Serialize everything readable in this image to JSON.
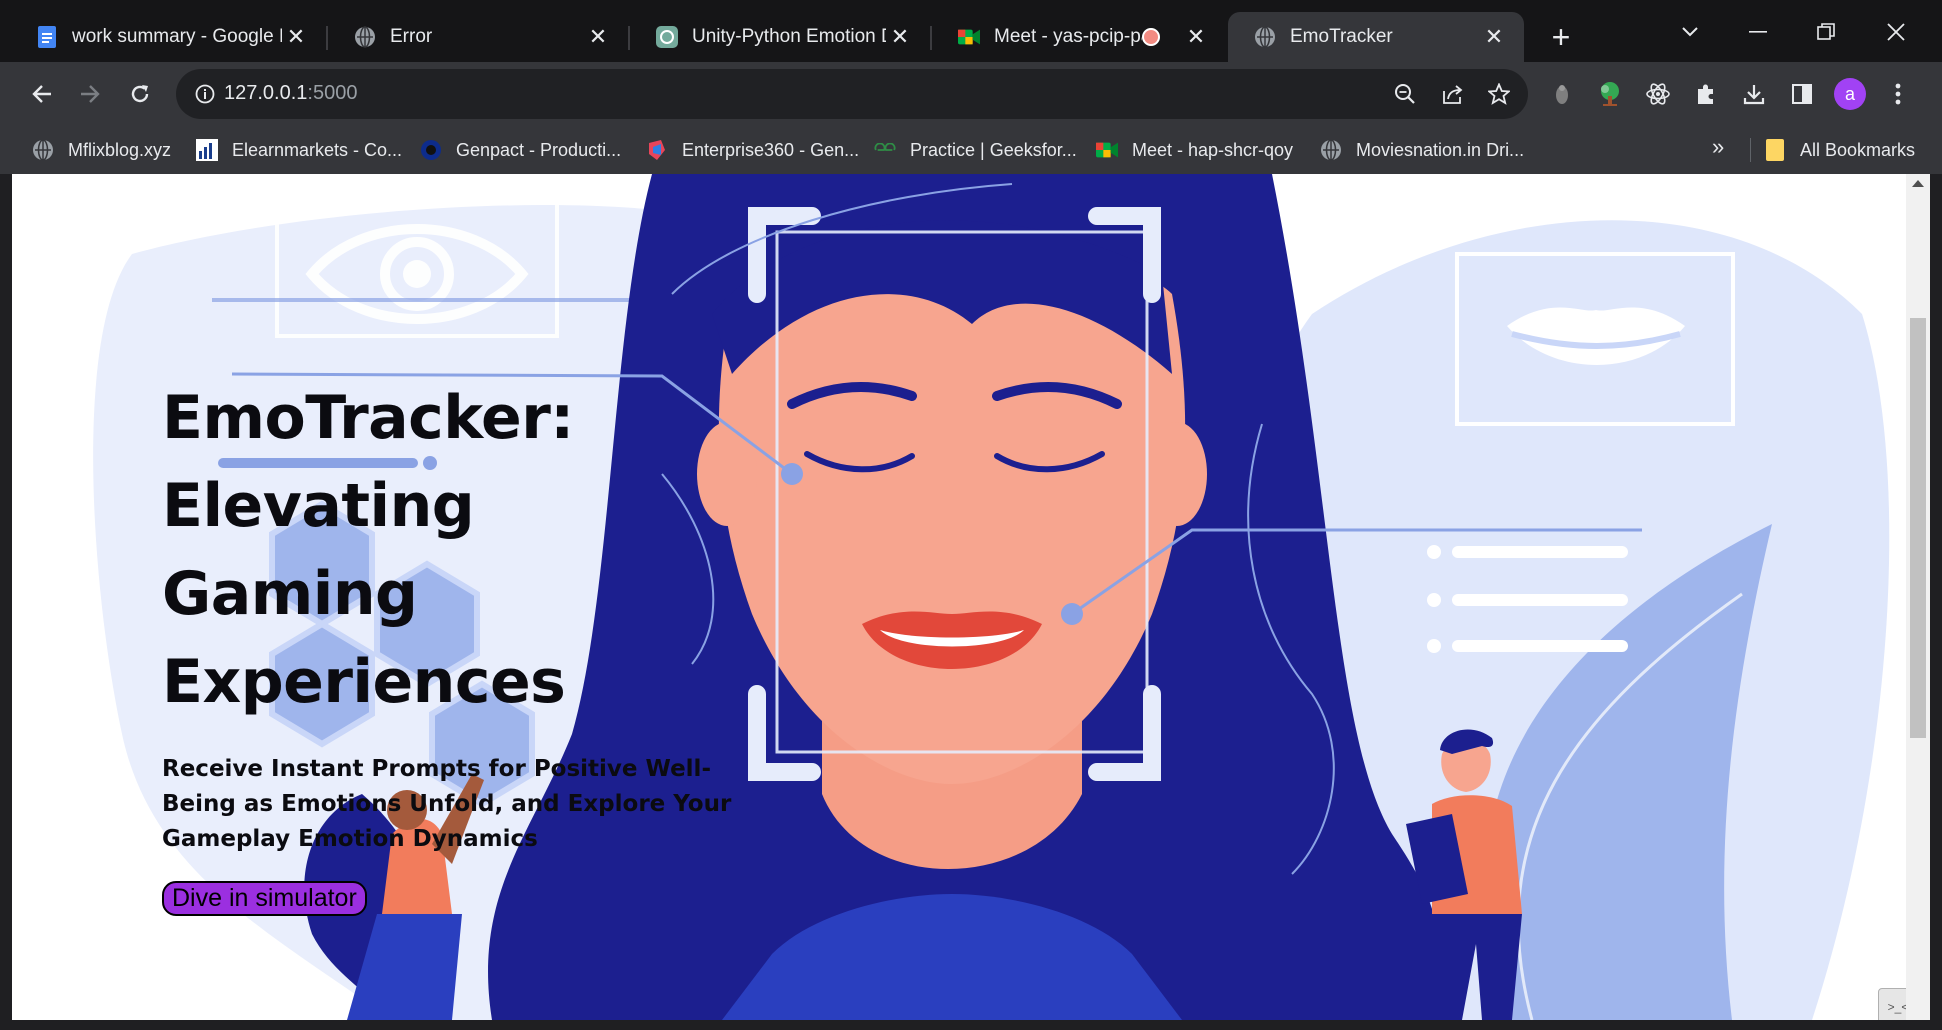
{
  "browser": {
    "tabs": [
      {
        "title": "work summary - Google D",
        "icon": "google-docs-icon"
      },
      {
        "title": "Error",
        "icon": "globe-icon"
      },
      {
        "title": "Unity-Python Emotion Da",
        "icon": "chatgpt-icon"
      },
      {
        "title": "Meet - yas-pcip-paj",
        "icon": "google-meet-icon",
        "recording": true
      },
      {
        "title": "EmoTracker",
        "icon": "globe-icon",
        "active": true
      }
    ],
    "url_host": "127.0.0.1",
    "url_port": ":5000",
    "avatar_letter": "a",
    "bookmarks": [
      {
        "label": "Mflixblog.xyz",
        "icon": "globe-icon"
      },
      {
        "label": "Elearnmarkets - Co...",
        "icon": "elearnmarkets-icon"
      },
      {
        "label": "Genpact - Producti...",
        "icon": "genpact-icon"
      },
      {
        "label": "Enterprise360 - Gen...",
        "icon": "enterprise360-icon"
      },
      {
        "label": "Practice | Geeksfor...",
        "icon": "geeksforgeeks-icon"
      },
      {
        "label": "Meet - hap-shcr-qoy",
        "icon": "google-meet-icon"
      },
      {
        "label": "Moviesnation.in Dri...",
        "icon": "globe-icon"
      }
    ],
    "bookmarks_overflow": "»",
    "all_bookmarks_label": "All Bookmarks"
  },
  "page": {
    "hero_title_line1": "EmoTracker:",
    "hero_title_line2": "Elevating Gaming",
    "hero_title_line3": "Experiences",
    "hero_subtitle": "Receive Instant Prompts for Positive Well-Being as Emotions Unfold, and Explore Your Gameplay Emotion Dynamics",
    "cta_label": "Dive in simulator"
  },
  "colors": {
    "navy": "#1c1f8f",
    "skin": "#f7a58f",
    "light_blue": "#c9d6f8",
    "cta_purple": "#9b2fe0"
  }
}
